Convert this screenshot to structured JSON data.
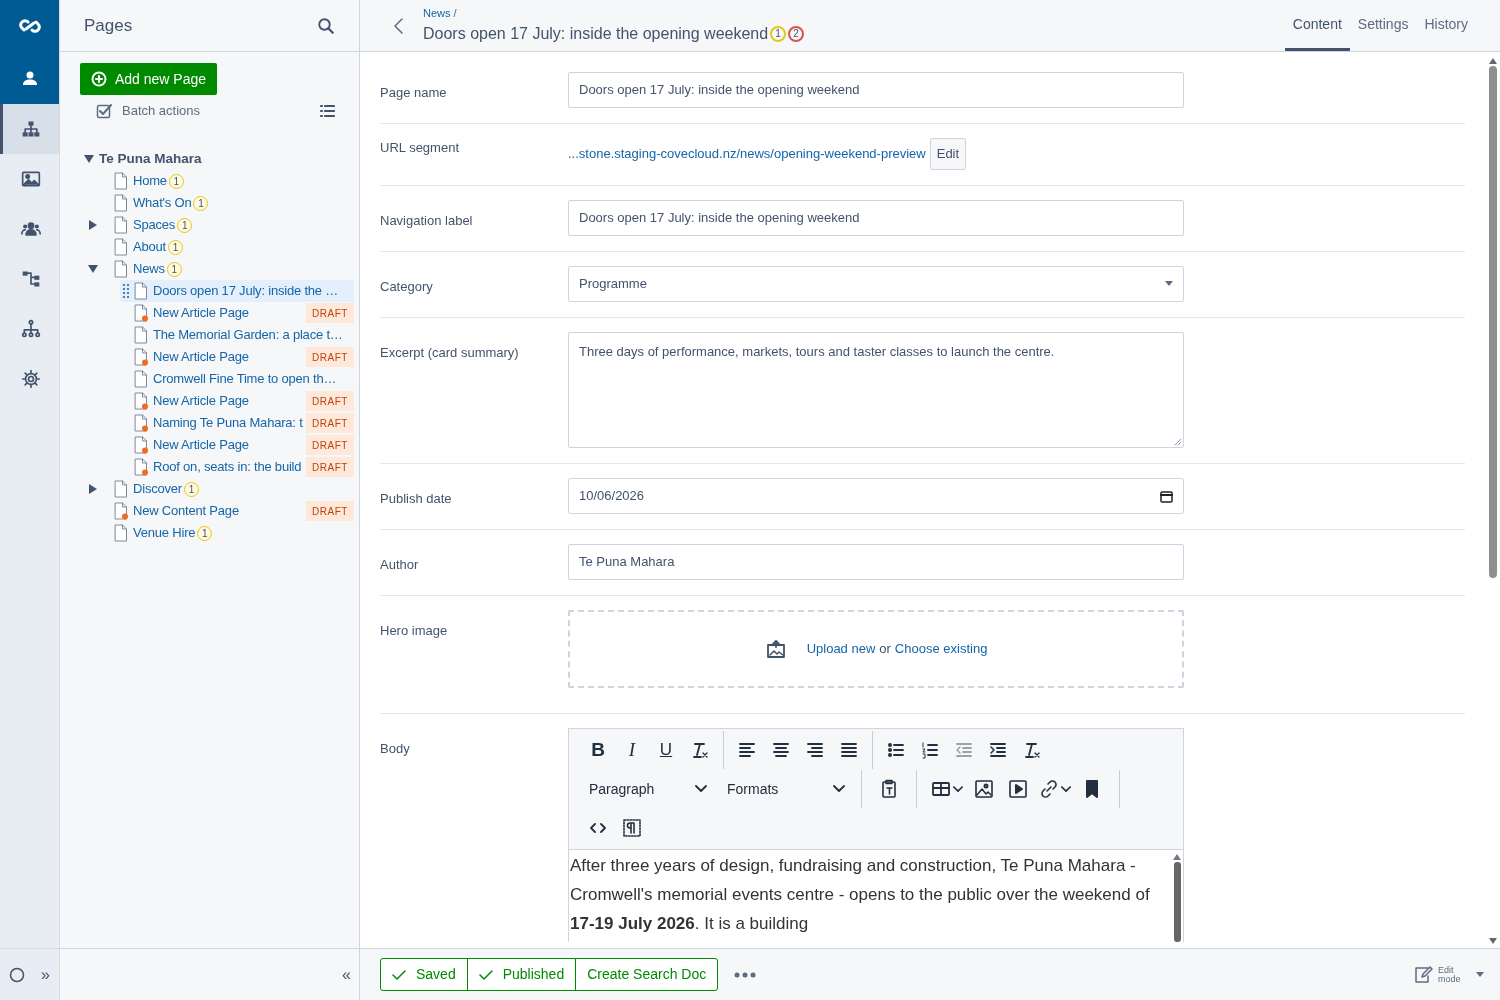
{
  "rail": {
    "items": [
      {
        "selected": true
      },
      {
        "selected": false
      },
      {
        "selected": false
      },
      {
        "selected": false
      },
      {
        "selected": false
      },
      {
        "selected": false
      }
    ],
    "expand_glyph": "»"
  },
  "tree_panel": {
    "title": "Pages",
    "add_button": "Add new Page",
    "batch_actions": "Batch actions",
    "collapse_glyph": "«"
  },
  "tree": {
    "label": "Te Puna Mahara",
    "expanded": true,
    "selected": false,
    "children": [
      {
        "label": "Home",
        "badge": "1",
        "selected": false
      },
      {
        "label": "What's On",
        "badge": "1",
        "selected": false
      },
      {
        "label": "Spaces",
        "badge": "1",
        "expanded": false,
        "selected": false
      },
      {
        "label": "About",
        "badge": "1",
        "selected": false
      },
      {
        "label": "News",
        "badge": "1",
        "expanded": true,
        "selected": false,
        "children": [
          {
            "label": "Doors open 17 July: inside the …",
            "selected": true
          },
          {
            "label": "New Article Page",
            "status": "DRAFT",
            "selected": false
          },
          {
            "label": "The Memorial Garden: a place t…",
            "selected": false
          },
          {
            "label": "New Article Page",
            "status": "DRAFT",
            "selected": false
          },
          {
            "label": "Cromwell Fine Time to open th…",
            "selected": false
          },
          {
            "label": "New Article Page",
            "status": "DRAFT",
            "selected": false
          },
          {
            "label": "Naming Te Puna Mahara: t",
            "status": "DRAFT",
            "selected": false
          },
          {
            "label": "New Article Page",
            "status": "DRAFT",
            "selected": false
          },
          {
            "label": "Roof on, seats in: the build",
            "status": "DRAFT",
            "selected": false
          }
        ]
      },
      {
        "label": "Discover",
        "badge": "1",
        "expanded": false,
        "selected": false
      },
      {
        "label": "New Content Page",
        "status": "DRAFT",
        "selected": false
      },
      {
        "label": "Venue Hire",
        "badge": "1",
        "selected": false
      }
    ]
  },
  "header": {
    "breadcrumb": "News",
    "breadcrumb_separator": "/",
    "title": "Doors open 17 July: inside the opening weekend",
    "badges": [
      {
        "text": "1",
        "color": "#e6c619"
      },
      {
        "text": "2",
        "color": "#d9534f"
      }
    ]
  },
  "tabs": [
    {
      "label": "Content",
      "selected": true
    },
    {
      "label": "Settings",
      "selected": false
    },
    {
      "label": "History",
      "selected": false
    }
  ],
  "fields": [
    {
      "kind": "text",
      "label": "Page name",
      "value": "Doors open 17 July: inside the opening weekend"
    },
    {
      "kind": "link",
      "label": "URL segment",
      "value": "...stone.staging-covecloud.nz/news/opening-weekend-preview",
      "button": "Edit"
    },
    {
      "kind": "text",
      "label": "Navigation label",
      "value": "Doors open 17 July: inside the opening weekend"
    },
    {
      "kind": "select",
      "label": "Category",
      "value": "Programme"
    },
    {
      "kind": "textarea",
      "label": "Excerpt (card summary)",
      "value": "Three days of performance, markets, tours and taster classes to launch the centre."
    },
    {
      "kind": "date",
      "label": "Publish date",
      "value": "10/06/2026"
    },
    {
      "kind": "text",
      "label": "Author",
      "value": "Te Puna Mahara"
    },
    {
      "kind": "upload",
      "label": "Hero image",
      "upload_link": "Upload new",
      "joiner": "or",
      "choose_link": "Choose existing"
    },
    {
      "kind": "editor",
      "label": "Body",
      "format_glyphs": [
        "B",
        "I",
        "U"
      ],
      "block_select": "Paragraph",
      "formats_select": "Formats",
      "content": "After three years of design, fundraising and construction, Te Puna Mahara - Cromwell's memorial events centre - opens to the public over the weekend of **17-19 July 2026**. It is a building"
    }
  ],
  "footer": {
    "actions": [
      {
        "label": "Saved",
        "checked": true
      },
      {
        "label": "Published",
        "checked": true
      },
      {
        "label": "Create Search Doc",
        "checked": false
      }
    ],
    "edit_mode": "Edit mode"
  }
}
